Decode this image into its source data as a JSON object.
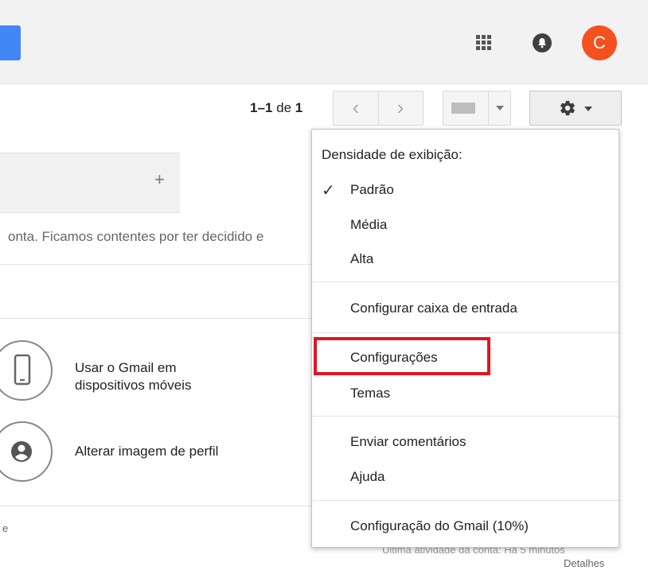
{
  "header": {
    "avatar_letter": "C",
    "accent_color": "#4285f4",
    "avatar_color": "#f4511e"
  },
  "toolbar": {
    "pager_range": "1–1",
    "pager_of": "de",
    "pager_total": "1",
    "prev_icon": "chevron-left-icon",
    "next_icon": "chevron-right-icon",
    "keyboard_icon": "keyboard-icon",
    "settings_icon": "gear-icon"
  },
  "content": {
    "tab_add": "+",
    "snippet": "onta. Ficamos contentes por ter decidido e",
    "setup": [
      {
        "icon": "phone-icon",
        "label_line1": "Usar o Gmail em",
        "label_line2": "dispositivos móveis"
      },
      {
        "icon": "person-icon",
        "label": "Alterar imagem de perfil"
      }
    ],
    "bottom_left": "e",
    "activity_partial": "Última atividade da conta: Há 5 minutos",
    "details": "Detalhes"
  },
  "menu": {
    "density_title": "Densidade de exibição:",
    "density_options": [
      "Padrão",
      "Média",
      "Alta"
    ],
    "selected_density": "Padrão",
    "configure_inbox": "Configurar caixa de entrada",
    "settings": "Configurações",
    "themes": "Temas",
    "feedback": "Enviar comentários",
    "help": "Ajuda",
    "gmail_setup": "Configuração do Gmail (10%)",
    "highlight_color": "#e4141f"
  }
}
